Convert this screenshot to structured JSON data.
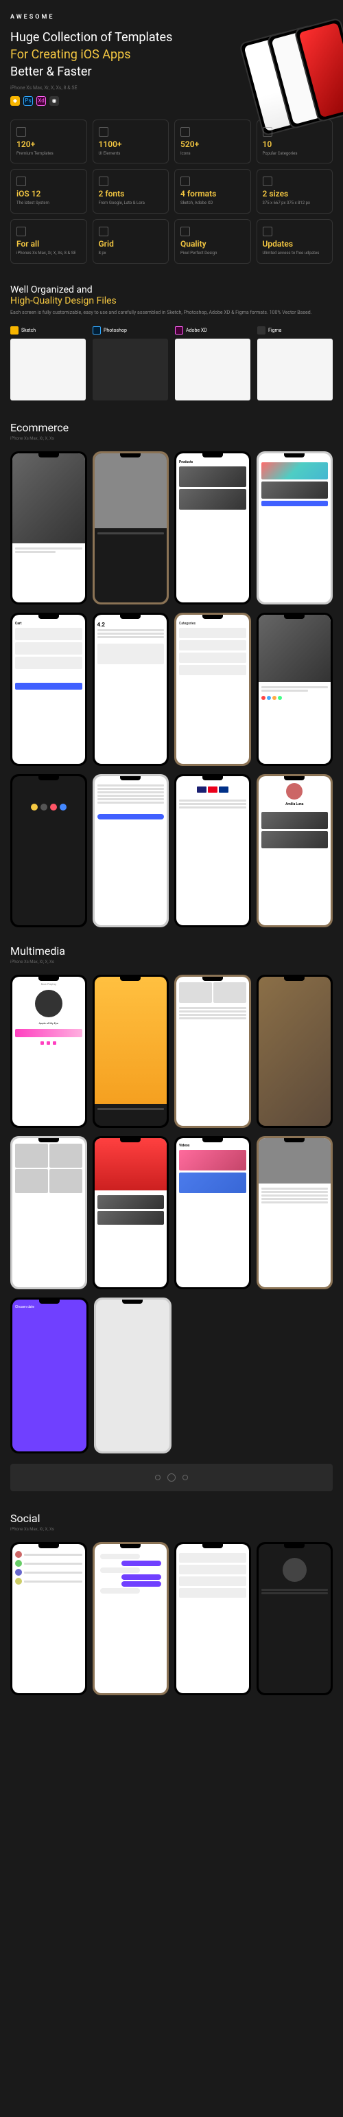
{
  "brand": "AWESOME",
  "hero": {
    "line1": "Huge Collection of Templates",
    "line2": "For Creating iOS Apps",
    "line3": "Better & Faster",
    "subtitle": "iPhone Xs Max, Xr, X, Xs, 8 & SE"
  },
  "tools": {
    "sketch": "Sketch",
    "ps": "Photoshop",
    "xd": "Adobe XD",
    "figma": "Figma"
  },
  "features": [
    {
      "value": "120+",
      "label": "Premium Templates"
    },
    {
      "value": "1100+",
      "label": "UI Elements"
    },
    {
      "value": "520+",
      "label": "Icons"
    },
    {
      "value": "10",
      "label": "Popular Categories"
    },
    {
      "value": "iOS 12",
      "label": "The latest System"
    },
    {
      "value": "2 fonts",
      "label": "From Google, Lato & Lora"
    },
    {
      "value": "4 formats",
      "label": "Sketch, Adobe XD"
    },
    {
      "value": "2 sizes",
      "label": "375 x 667 px 375 x 812 px"
    },
    {
      "value": "For all",
      "label": "iPhones Xs Max, Xr, X, Xs, 8 & SE"
    },
    {
      "value": "Grid",
      "label": "8 px"
    },
    {
      "value": "Quality",
      "label": "Pixel Perfect Design"
    },
    {
      "value": "Updates",
      "label": "Ulimted access to free udpates"
    }
  ],
  "organized": {
    "line1": "Well Organized and",
    "line2": "High-Quality Design Files",
    "desc": "Each screen is fully customizable, easy to use and carefully assembled in Sketch, Photoshop, Adobe XD & Figma formats. 100% Vector Based."
  },
  "fileTypes": [
    {
      "name": "Sketch",
      "color": "#f7b500"
    },
    {
      "name": "Photoshop",
      "color": "#31a8ff"
    },
    {
      "name": "Adobe XD",
      "color": "#ff61f6"
    },
    {
      "name": "Figma",
      "color": "#a259ff"
    }
  ],
  "categories": {
    "ecommerce": {
      "title": "Ecommerce",
      "sub": "iPhone Xs Max, Xr, X, Xs"
    },
    "multimedia": {
      "title": "Multimedia",
      "sub": "iPhone Xs Max, Xr, X, Xs"
    },
    "social": {
      "title": "Social",
      "sub": "iPhone Xs Max, Xr, X, Xs"
    }
  },
  "ecommerceScreens": {
    "products": "Products",
    "cart": "Cart",
    "rating": "4.2",
    "profile": "Amilia Luna",
    "categories": "Categories"
  },
  "multimediaScreens": {
    "nowPlaying": "Now Playing",
    "track": "Apple of My Eye",
    "chosenDate": "Chosen date",
    "videos": "Videos"
  }
}
